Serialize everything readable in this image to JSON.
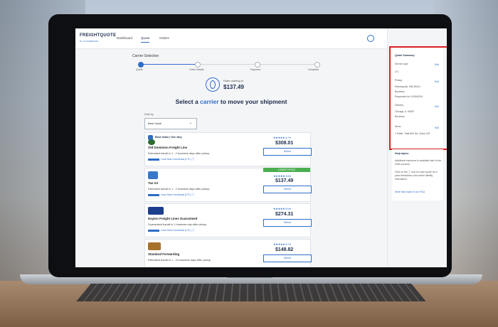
{
  "app": {
    "logo": "FREIGHTQUOTE",
    "logo_sub": "BY CH ROBINSON",
    "nav": [
      "Dashboard",
      "Quote",
      "Orders"
    ]
  },
  "page": {
    "title": "Carrier Selection",
    "steps": [
      "Quote",
      "Order Details",
      "Payment",
      "Complete"
    ],
    "rates_label": "Rates starting at",
    "rates_value": "$137.49",
    "headline_pre": "Select a ",
    "headline_accent": "carrier",
    "headline_post": " to move your shipment",
    "sort_label": "Sort by",
    "sort_value": "Best Value"
  },
  "carriers": [
    {
      "badge": "Best Value | See why",
      "name": "Old Dominion Freight Line",
      "stars": "★★★★★ 4.7 ▾",
      "price": "$308.01",
      "transit": "Estimated transit is 1 - 2 business days after pickup",
      "tag": "Less than truckload (LTL)",
      "select": "Select",
      "color": "#2e6b2e"
    },
    {
      "badge": "",
      "name": "Tax Air",
      "stars": "★★★★★ 4.5 ▾",
      "price": "$137.49",
      "transit": "Estimated transit is 1 - 2 business days after pickup",
      "tag": "Less than truckload (LTL)",
      "select": "Select",
      "lowest": "LOWEST PRICE",
      "color": "#3a78c9"
    },
    {
      "badge": "",
      "name": "Dayton Freight Lines Guaranteed",
      "stars": "★★★★★ 5.0 ▾",
      "price": "$274.31",
      "transit": "Guaranteed transit is 1 business day after pickup",
      "tag": "Less than truckload (LTL)",
      "select": "Select",
      "color": "#1b3f8c"
    },
    {
      "badge": "",
      "name": "Standard Forwarding",
      "stars": "★★★★★ 4.7 ▾",
      "price": "$148.82",
      "transit": "Estimated transit is 1 - 2x business days after pickup",
      "tag": "",
      "select": "Select",
      "color": "#a8712a"
    }
  ],
  "summary": {
    "title": "Quote Summary",
    "service_type": "Service type",
    "service_value": "LTL",
    "pickup": "Pickup",
    "pickup_lines": [
      "Minneapolis, MN 55413",
      "Business",
      "Requested for 01/05/2024"
    ],
    "delivery": "Delivery",
    "delivery_lines": [
      "Chicago, IL 60637",
      "Business"
    ],
    "items": "Items",
    "items_value": "1 Pallet, Total 800 lbs, Class 125",
    "edit": "Edit"
  },
  "help": {
    "title": "Help topics",
    "text1": "Additional insurance is available later in the order process.",
    "text2": "Click on the ⓘ icon for each quote for a price breakdown and carrier liability information.",
    "link": "More help topics in our FAQ"
  }
}
